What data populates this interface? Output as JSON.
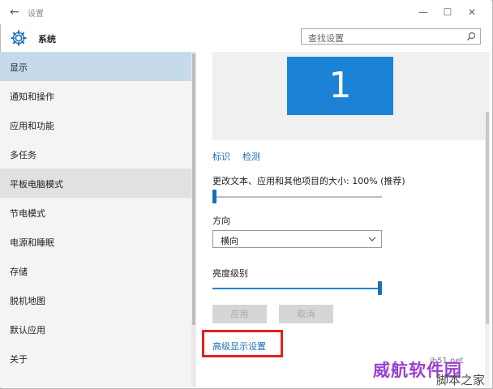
{
  "window": {
    "title": "设置",
    "back_icon": "arrow-left-icon",
    "minimize": "—",
    "maximize": "☐",
    "close": "✕"
  },
  "header": {
    "title": "系统",
    "icon": "gear-icon"
  },
  "search": {
    "placeholder": "查找设置",
    "icon": "search-icon"
  },
  "sidebar": {
    "items": [
      {
        "label": "显示",
        "state": "selected"
      },
      {
        "label": "通知和操作"
      },
      {
        "label": "应用和功能"
      },
      {
        "label": "多任务"
      },
      {
        "label": "平板电脑模式",
        "state": "hover"
      },
      {
        "label": "节电模式"
      },
      {
        "label": "电源和睡眠"
      },
      {
        "label": "存储"
      },
      {
        "label": "脱机地图"
      },
      {
        "label": "默认应用"
      },
      {
        "label": "关于"
      }
    ]
  },
  "display": {
    "monitor_number": "1",
    "identify_link": "标识",
    "detect_link": "检测",
    "scale_label": "更改文本、应用和其他项目的大小: 100% (推荐)",
    "scale_slider_value": 0,
    "orientation_label": "方向",
    "orientation_value": "横向",
    "brightness_label": "亮度级别",
    "brightness_slider_value": 1.0,
    "apply_button": "应用",
    "cancel_button": "取消",
    "advanced_link": "高级显示设置"
  },
  "colors": {
    "accent": "#1c82d6",
    "selected_nav": "#c6daeb",
    "highlight_box": "#e02020"
  },
  "watermark": {
    "text": "脚本之家",
    "brand": "威航软件园",
    "domain": "jb51.net"
  }
}
